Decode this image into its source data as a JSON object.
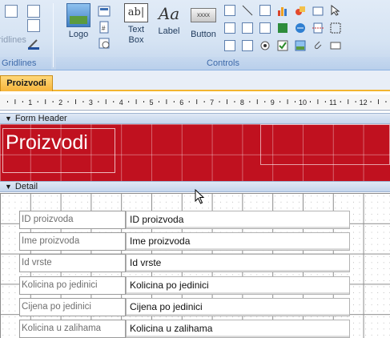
{
  "ribbon": {
    "gridlines_partial_text": "ridlines",
    "gridlines_group_label": "Gridlines",
    "controls_group_label": "Controls",
    "buttons": {
      "logo": "Logo",
      "text_box_line1": "Text",
      "text_box_line2": "Box",
      "label": "Label",
      "button": "Button",
      "button_icon_text": "xxxx",
      "textbox_icon_text": "ab|"
    }
  },
  "document_tab": {
    "label": "Proizvodi"
  },
  "ruler": {
    "numbers": [
      "1",
      "2",
      "3",
      "4",
      "5",
      "6",
      "7",
      "8",
      "9",
      "10",
      "11",
      "12"
    ]
  },
  "sections": {
    "form_header": "Form Header",
    "detail": "Detail"
  },
  "form_header": {
    "title": "Proizvodi",
    "color": "#c0111f"
  },
  "detail_rows": [
    {
      "label": "ID proizvoda",
      "field": "ID proizvoda"
    },
    {
      "label": "Ime proizvoda",
      "field": "Ime proizvoda"
    },
    {
      "label": "Id vrste",
      "field": "Id vrste"
    },
    {
      "label": "Kolicina po jedinici",
      "field": "Kolicina po jedinici"
    },
    {
      "label": "Cijena po jedinici",
      "field": "Cijena po jedinici"
    },
    {
      "label": "Kolicina u zalihama",
      "field": "Kolicina u zalihama"
    }
  ]
}
